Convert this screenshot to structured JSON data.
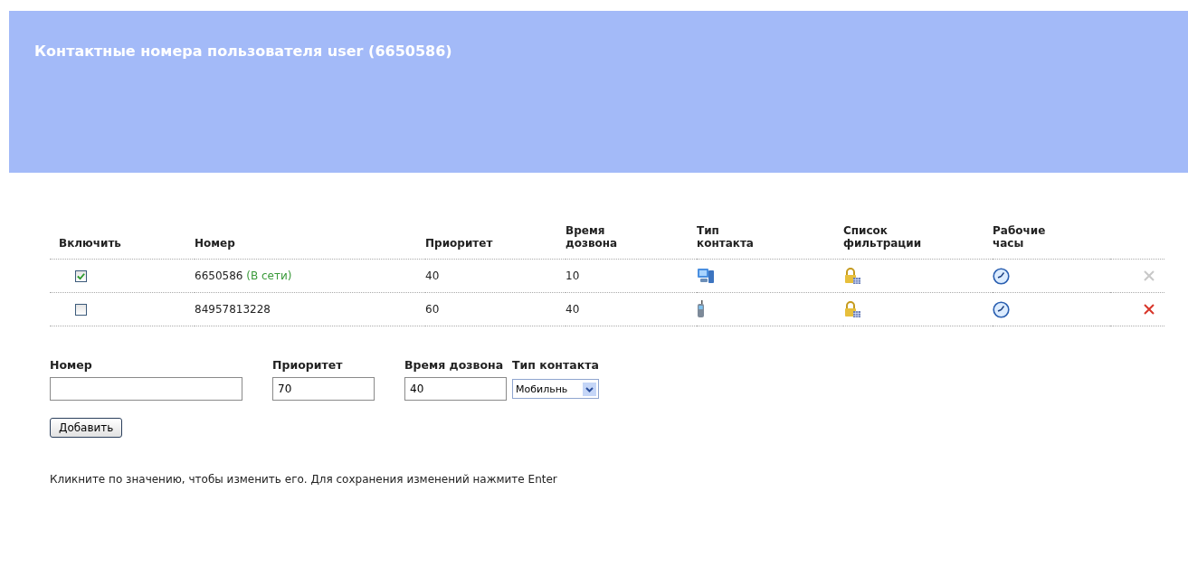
{
  "header": {
    "title": "Контактные номера пользователя user (6650586)"
  },
  "table": {
    "columns": [
      "Включить",
      "Номер",
      "Приоритет",
      "Время дозвона",
      "Тип контакта",
      "Список фильтрации",
      "Рабочие часы"
    ],
    "rows": [
      {
        "checked": true,
        "number": "6650586",
        "status": "(В сети)",
        "priority": "40",
        "dial_time": "10",
        "kind": "computer",
        "delete_disabled": true
      },
      {
        "checked": false,
        "number": "84957813228",
        "priority": "60",
        "dial_time": "40",
        "kind": "mobile",
        "delete_disabled": false
      }
    ]
  },
  "form": {
    "number": {
      "label": "Номер"
    },
    "priority": {
      "label": "Приоритет",
      "value": "70"
    },
    "dial_time": {
      "label": "Время дозвона",
      "value": "40"
    },
    "contact_type": {
      "label": "Тип контакта",
      "value": "Мобильнь"
    },
    "add_button": "Добавить"
  },
  "hint": "Кликните по значению, чтобы изменить его. Для сохранения изменений нажмите Enter"
}
